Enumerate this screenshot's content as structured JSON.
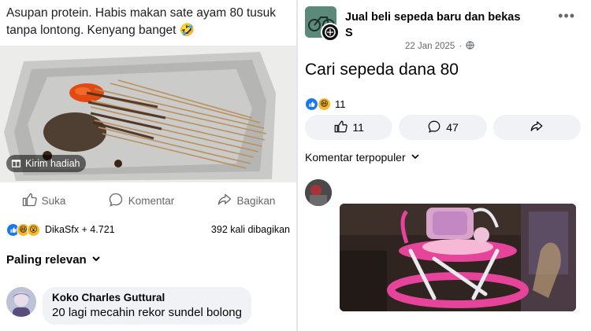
{
  "left_post": {
    "caption": "Asupan protein. Habis makan sate ayam 80 tusuk tanpa lontong. Kenyang banget 🤣",
    "gift_label": "Kirim hadiah",
    "actions": {
      "like": "Suka",
      "comment": "Komentar",
      "share": "Bagikan"
    },
    "reactions_names": "DikaSfx + 4.721",
    "shares": "392 kali dibagikan",
    "sort_label": "Paling relevan",
    "comment": {
      "author": "Koko Charles Guttural",
      "text": "20 lagi mecahin rekor sundel bolong"
    }
  },
  "right_post": {
    "group_name": "Jual beli sepeda  baru dan bekas",
    "user_name": "S",
    "date": "22 Jan 2025",
    "separator": "·",
    "more": "•••",
    "title": "Cari sepeda dana 80",
    "reaction_count": "11",
    "buttons": {
      "like_count": "11",
      "comment_count": "47"
    },
    "sort_label": "Komentar terpopuler"
  },
  "colors": {
    "like_blue": "#1877f2",
    "haha_yellow": "#f7b928",
    "pill_bg": "#f0f2f5",
    "secondary_text": "#65676b",
    "walker_pink": "#e6449a"
  },
  "icons": [
    "gift-icon",
    "like-icon",
    "comment-icon",
    "share-icon",
    "chevron-down-icon",
    "globe-icon",
    "more-icon"
  ]
}
